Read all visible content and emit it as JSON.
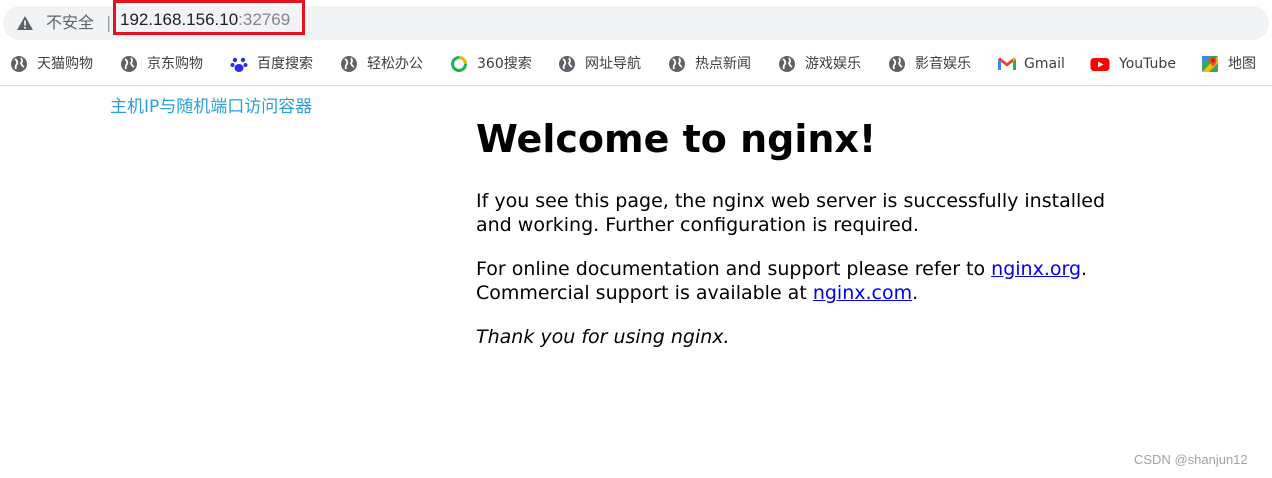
{
  "address_bar": {
    "security_label": "不安全",
    "separator": "|",
    "url_host": "192.168.156.10",
    "url_port": ":32769"
  },
  "bookmarks": [
    {
      "label": "天猫购物",
      "icon": "globe-icon"
    },
    {
      "label": "京东购物",
      "icon": "globe-icon"
    },
    {
      "label": "百度搜索",
      "icon": "baidu-paw-icon"
    },
    {
      "label": "轻松办公",
      "icon": "globe-icon"
    },
    {
      "label": "360搜索",
      "icon": "360-search-icon"
    },
    {
      "label": "网址导航",
      "icon": "globe-icon"
    },
    {
      "label": "热点新闻",
      "icon": "globe-icon"
    },
    {
      "label": "游戏娱乐",
      "icon": "globe-icon"
    },
    {
      "label": "影音娱乐",
      "icon": "globe-icon"
    },
    {
      "label": "Gmail",
      "icon": "gmail-icon"
    },
    {
      "label": "YouTube",
      "icon": "youtube-icon"
    },
    {
      "label": "地图",
      "icon": "maps-icon"
    }
  ],
  "page": {
    "broken_image_alt": "主机IP与随机端口访问容器",
    "heading": "Welcome to nginx!",
    "para1": "If you see this page, the nginx web server is successfully installed and working. Further configuration is required.",
    "para2_prefix": "For online documentation and support please refer to ",
    "link_org": "nginx.org",
    "para2_mid": ".",
    "para2_line2": "Commercial support is available at ",
    "link_com": "nginx.com",
    "para2_end": ".",
    "para3": "Thank you for using nginx."
  },
  "watermark": "CSDN @shanjun12",
  "colors": {
    "highlight_box": "#e8121f",
    "link": "#0000ee",
    "alt_text": "#2aa0d4"
  }
}
